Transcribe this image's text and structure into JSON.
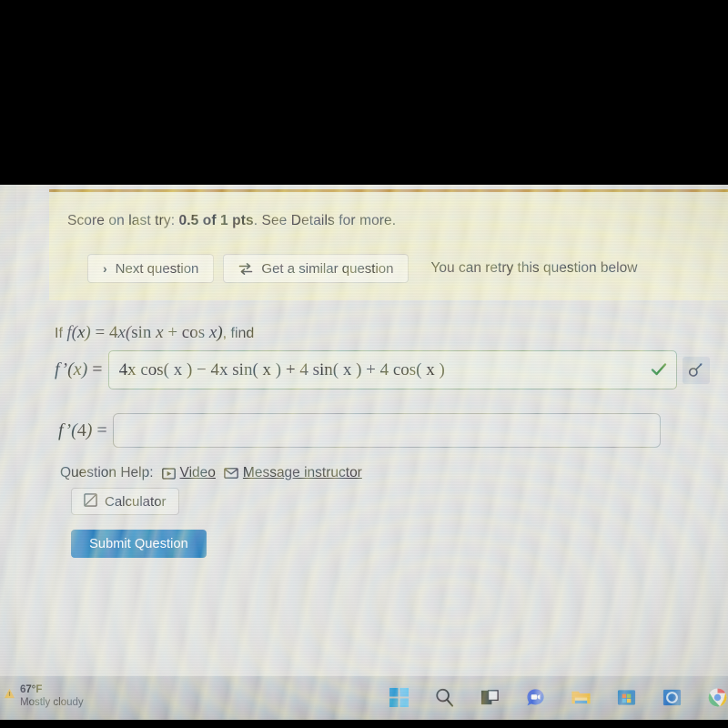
{
  "alert": {
    "score_prefix": "Score on last try: ",
    "score_value": "0.5 of 1 pts",
    "score_suffix": ". See Details for more.",
    "next_question_label": "Next question",
    "similar_question_label": "Get a similar question",
    "retry_text": "You can retry this question below",
    "border_color": "#b5883a",
    "background": "#e7e5c4"
  },
  "question": {
    "prompt_prefix": "If ",
    "prompt_function": "f(x) = 4x(sin x + cos x)",
    "prompt_suffix": ", find",
    "derivative_label": "f'(x) =",
    "answer_value": "4x cos( x ) − 4x sin( x ) + 4 sin( x ) + 4 cos( x )",
    "answer_status": "correct",
    "check_icon": "check-icon",
    "preview_icon": "answer-preview-icon",
    "eval_label": "f'(4) =",
    "eval_value": "",
    "eval_placeholder": ""
  },
  "help": {
    "label": "Question Help:",
    "video_label": "Video",
    "video_icon": "play-box-icon",
    "message_label": "Message instructor",
    "message_icon": "envelope-icon",
    "calculator_label": "Calculator",
    "calculator_icon": "calculator-icon"
  },
  "actions": {
    "submit_label": "Submit Question",
    "submit_color": "#1f6eb0"
  },
  "taskbar": {
    "weather_temp": "67°F",
    "weather_condition": "Mostly cloudy",
    "weather_icon": "weather-alert-icon",
    "items": [
      {
        "name": "start-icon",
        "label": "Start"
      },
      {
        "name": "search-icon",
        "label": "Search"
      },
      {
        "name": "task-view-icon",
        "label": "Task View"
      },
      {
        "name": "zoom-icon",
        "label": "Zoom"
      },
      {
        "name": "file-explorer-icon",
        "label": "File Explorer"
      },
      {
        "name": "microsoft-store-icon",
        "label": "Microsoft Store"
      },
      {
        "name": "outlook-icon",
        "label": "Outlook"
      },
      {
        "name": "chrome-icon",
        "label": "Google Chrome"
      }
    ]
  }
}
